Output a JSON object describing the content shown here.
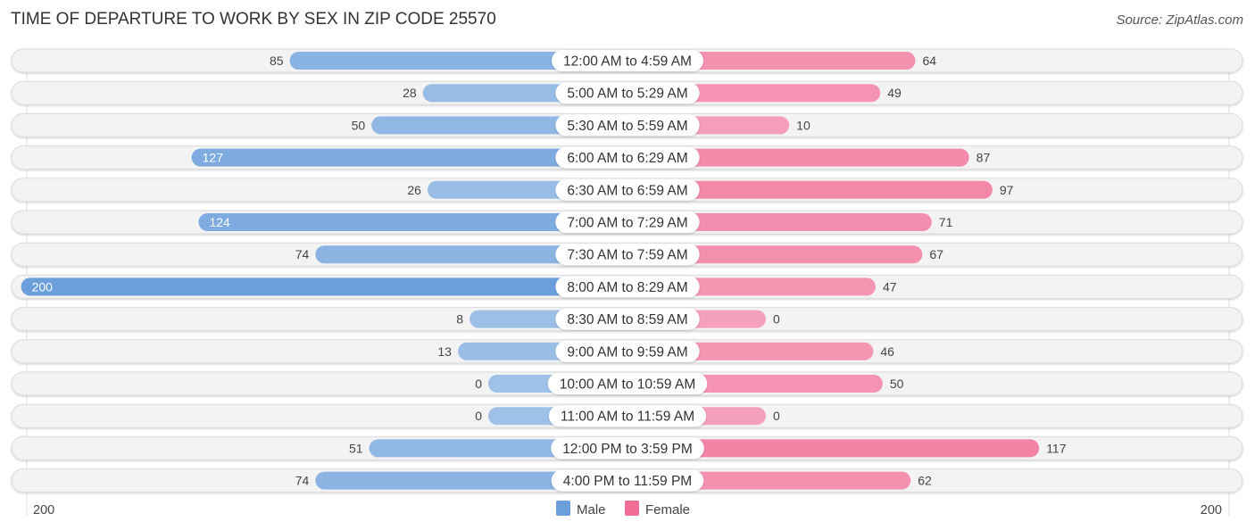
{
  "header": {
    "title": "TIME OF DEPARTURE TO WORK BY SEX IN ZIP CODE 25570",
    "source": "Source: ZipAtlas.com"
  },
  "chart_data": {
    "type": "bar",
    "orientation": "horizontal-diverging",
    "title": "TIME OF DEPARTURE TO WORK BY SEX IN ZIP CODE 25570",
    "categories": [
      "12:00 AM to 4:59 AM",
      "5:00 AM to 5:29 AM",
      "5:30 AM to 5:59 AM",
      "6:00 AM to 6:29 AM",
      "6:30 AM to 6:59 AM",
      "7:00 AM to 7:29 AM",
      "7:30 AM to 7:59 AM",
      "8:00 AM to 8:29 AM",
      "8:30 AM to 8:59 AM",
      "9:00 AM to 9:59 AM",
      "10:00 AM to 10:59 AM",
      "11:00 AM to 11:59 AM",
      "12:00 PM to 3:59 PM",
      "4:00 PM to 11:59 PM"
    ],
    "series": [
      {
        "name": "Male",
        "color": "#6a9fdb",
        "side": "left",
        "values": [
          85,
          28,
          50,
          127,
          26,
          124,
          74,
          200,
          8,
          13,
          0,
          0,
          51,
          74
        ]
      },
      {
        "name": "Female",
        "color": "#f06e96",
        "side": "right",
        "values": [
          64,
          49,
          10,
          87,
          97,
          71,
          67,
          47,
          0,
          46,
          50,
          0,
          117,
          62
        ]
      }
    ],
    "axis": {
      "left_label": "200",
      "right_label": "200",
      "max": 200
    },
    "legend": {
      "position": "bottom-center",
      "items": [
        "Male",
        "Female"
      ]
    },
    "xlabel": "",
    "ylabel": ""
  }
}
